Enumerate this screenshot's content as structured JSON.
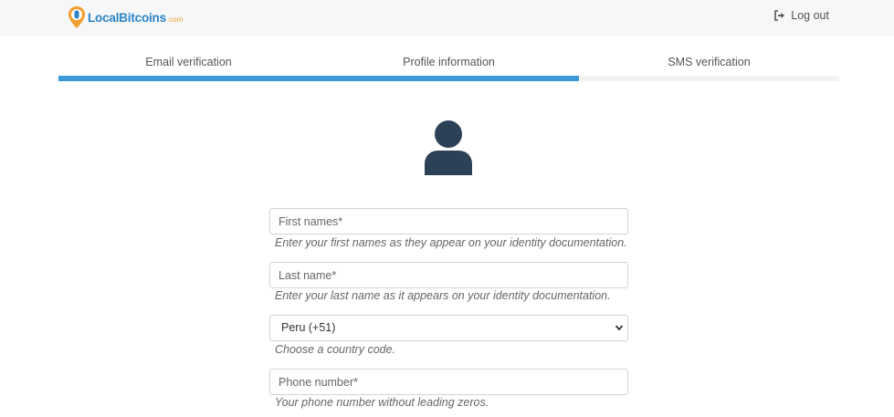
{
  "header": {
    "logo_text": "LocalBitcoins",
    "logo_suffix": ".com",
    "logout_label": "Log out",
    "logout_icon": "sign-out-icon"
  },
  "steps": {
    "items": [
      {
        "label": "Email verification"
      },
      {
        "label": "Profile information"
      },
      {
        "label": "SMS verification"
      }
    ],
    "completed_fraction": 0.667,
    "progress_color": "#3a9ad9"
  },
  "avatar": {
    "icon": "user-icon",
    "color": "#2d4156"
  },
  "form": {
    "first_names": {
      "placeholder": "First names*",
      "value": "",
      "help": "Enter your first names as they appear on your identity documentation."
    },
    "last_name": {
      "placeholder": "Last name*",
      "value": "",
      "help": "Enter your last name as it appears on your identity documentation."
    },
    "country_code": {
      "selected": "Peru (+51)",
      "help": "Choose a country code."
    },
    "phone_number": {
      "placeholder": "Phone number*",
      "value": "",
      "help": "Your phone number without leading zeros."
    }
  }
}
